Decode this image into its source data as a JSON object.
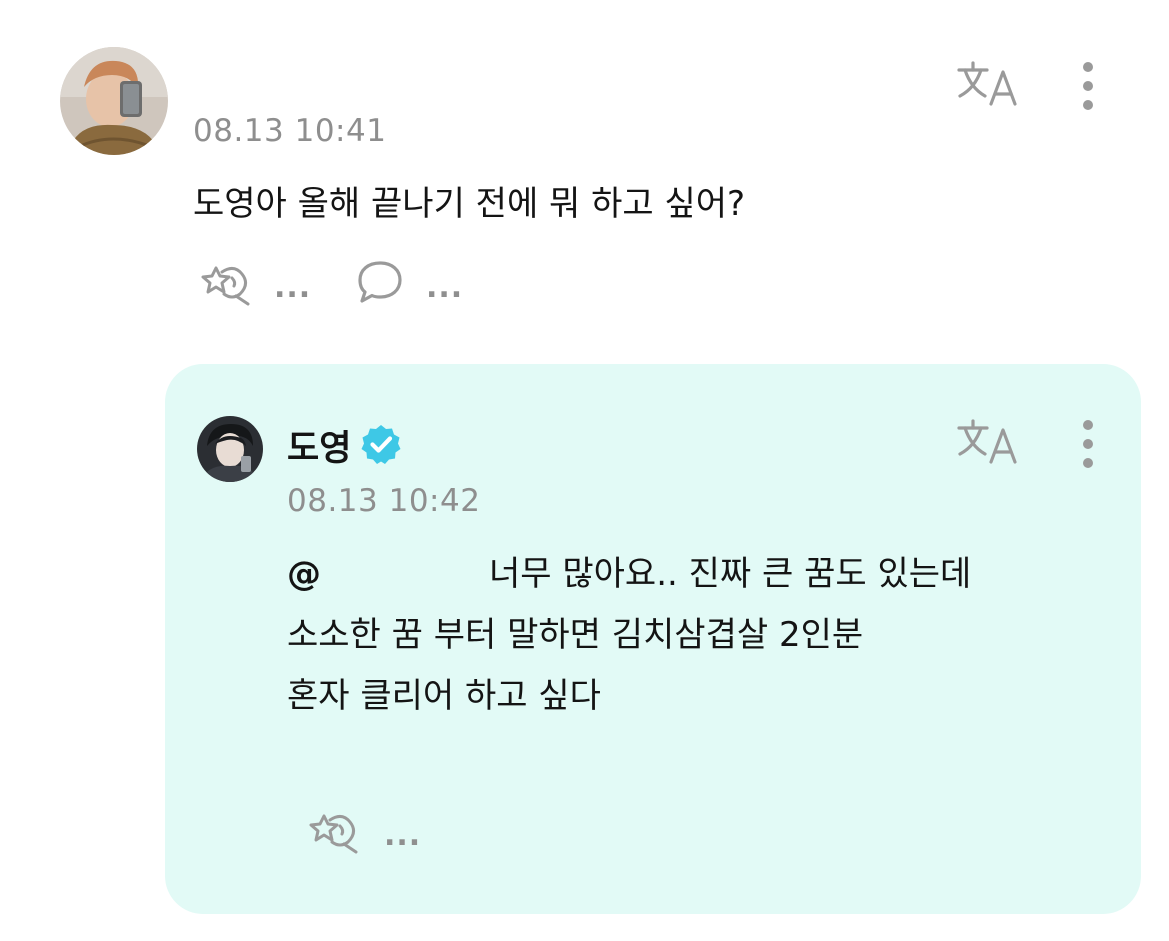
{
  "post": {
    "avatar_icon": "user-avatar-photo",
    "timestamp": "08.13 10:41",
    "text": "도영아 올해 끝나기 전에 뭐 하고 싶어?",
    "like_count": "...",
    "comment_count": "...",
    "translate_icon": "translate-icon",
    "more_icon": "more-vertical-icon"
  },
  "reply": {
    "avatar_icon": "artist-avatar-photo",
    "author": "도영",
    "verified_icon": "verified-badge-icon",
    "timestamp": "08.13 10:42",
    "mention": "@",
    "line1": "너무 많아요.. 진짜 큰 꿈도 있는데",
    "line2": "소소한 꿈 부터 말하면 김치삼겹살 2인분",
    "line3": "혼자 클리어 하고 싶다",
    "like_count": "...",
    "translate_icon": "translate-icon",
    "more_icon": "more-vertical-icon",
    "background": "#e2faf6"
  },
  "colors": {
    "verified": "#3ec8e6",
    "secondary_text": "#8e8e8e",
    "icon_gray": "#9a9a9a"
  }
}
